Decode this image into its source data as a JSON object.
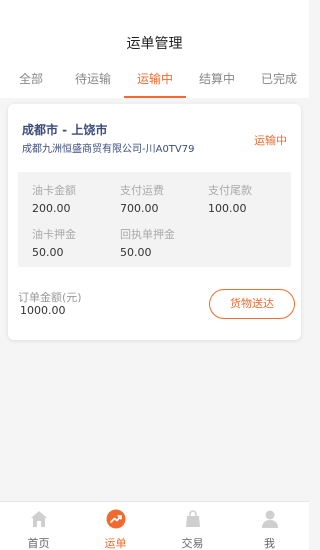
{
  "header": {
    "title": "运单管理",
    "tabs": [
      {
        "label": "全部"
      },
      {
        "label": "待运输"
      },
      {
        "label": "运输中"
      },
      {
        "label": "结算中"
      },
      {
        "label": "已完成"
      }
    ],
    "active_tab": "运输中"
  },
  "order": {
    "route": "成都市 - 上饶市",
    "company": "成都九洲恒盛商贸有限公司-川A0TV79",
    "status": "运输中",
    "fees": {
      "fuel_card_amount_label": "油卡金额",
      "fuel_card_amount": "200.00",
      "freight_paid_label": "支付运费",
      "freight_paid": "700.00",
      "balance_paid_label": "支付尾款",
      "balance_paid": "100.00",
      "fuel_card_deposit_label": "油卡押金",
      "fuel_card_deposit": "50.00",
      "receipt_deposit_label": "回执单押金",
      "receipt_deposit": "50.00"
    },
    "total_label": "订单金额(元)",
    "total_value": "1000.00",
    "deliver_button": "货物送达"
  },
  "tabbar": {
    "items": [
      {
        "label": "首页",
        "icon": "home-icon"
      },
      {
        "label": "运单",
        "icon": "trend-icon"
      },
      {
        "label": "交易",
        "icon": "bag-icon"
      },
      {
        "label": "我",
        "icon": "user-icon"
      }
    ],
    "active": "运单"
  },
  "colors": {
    "accent": "#f26a2e",
    "route_text": "#3c4d7c",
    "icon_inactive": "#cfcfcf"
  }
}
